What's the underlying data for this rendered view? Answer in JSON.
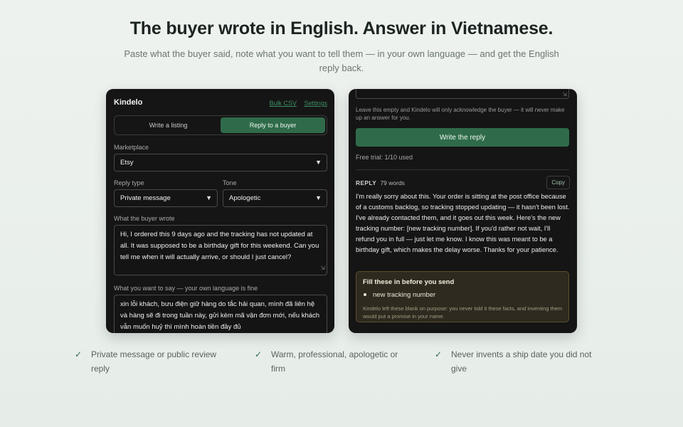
{
  "hero": {
    "title": "The buyer wrote in English. Answer in Vietnamese.",
    "subtitle": "Paste what the buyer said, note what you want to tell them — in your own language — and get the English reply back."
  },
  "left_panel": {
    "brand": "Kindelo",
    "links": {
      "bulk_csv": "Bulk CSV",
      "settings": "Settings"
    },
    "modes": {
      "write_listing": "Write a listing",
      "reply_buyer": "Reply to a buyer",
      "active": "reply_buyer"
    },
    "marketplace": {
      "label": "Marketplace",
      "value": "Etsy"
    },
    "reply_type": {
      "label": "Reply type",
      "value": "Private message"
    },
    "tone": {
      "label": "Tone",
      "value": "Apologetic"
    },
    "buyer_wrote": {
      "label": "What the buyer wrote",
      "value": "Hi, I ordered this 9 days ago and the tracking has not updated at all. It was supposed to be a birthday gift for this weekend. Can you tell me when it will actually arrive, or should I just cancel?"
    },
    "you_say": {
      "label": "What you want to say — your own language is fine",
      "value": "xin lỗi khách, bưu điện giữ hàng do tắc hải quan, mình đã liên hệ và hàng sẽ đi trong tuần này, gửi kèm mã vận đơn mới, nếu khách vẫn muốn huỷ thì mình hoàn tiền đầy đủ"
    }
  },
  "right_panel": {
    "hint": "Leave this empty and Kindelo will only acknowledge the buyer — it will never make up an answer for you.",
    "write_button": "Write the reply",
    "trial": "Free trial: 1/10 used",
    "reply_label": "REPLY",
    "word_count": "79 words",
    "copy_label": "Copy",
    "reply_text": "I'm really sorry about this. Your order is sitting at the post office because of a customs backlog, so tracking stopped updating — it hasn't been lost. I've already contacted them, and it goes out this week. Here's the new tracking number: [new tracking number]. If you'd rather not wait, I'll refund you in full — just let me know. I know this was meant to be a birthday gift, which makes the delay worse. Thanks for your patience.",
    "fill_box": {
      "title": "Fill these in before you send",
      "items": [
        "new tracking number"
      ],
      "note": "Kindelo left these blank on purpose: you never told it these facts, and inventing them would put a promise in your name."
    }
  },
  "features": [
    "Private message or public review reply",
    "Warm, professional, apologetic or firm",
    "Never invents a ship date you did not give"
  ],
  "colors": {
    "accent": "#2f6b4a",
    "panel_bg": "#151515",
    "page_bg": "#eef2ef",
    "warning_bg": "#2e2a1f"
  }
}
